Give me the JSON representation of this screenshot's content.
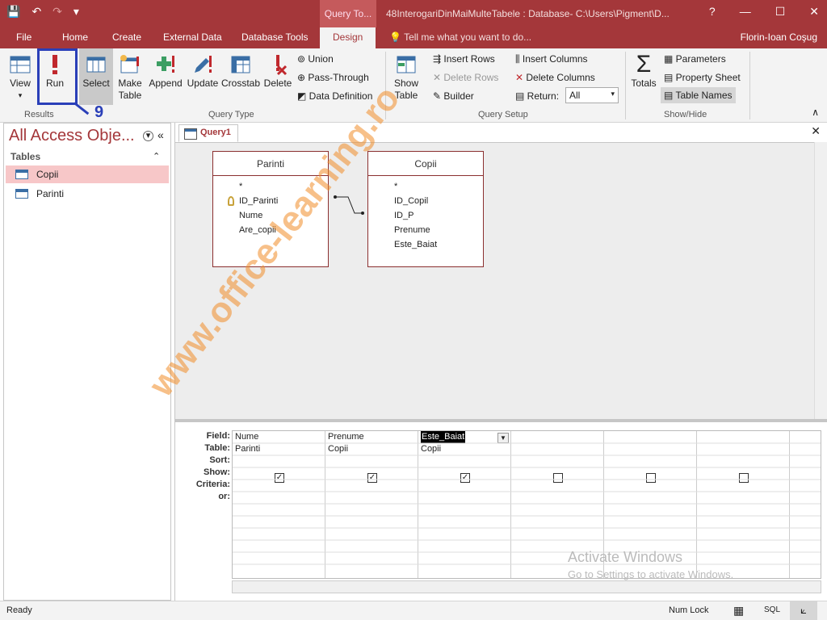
{
  "titlebar": {
    "context_tab": "Query To...",
    "document": "48InterogariDinMaiMulteTabele : Database- C:\\Users\\Pigment\\D...",
    "help": "?",
    "minimize": "—",
    "maximize": "☐",
    "close": "✕"
  },
  "tabs": {
    "file": "File",
    "home": "Home",
    "create": "Create",
    "external": "External Data",
    "dbtools": "Database Tools",
    "design": "Design",
    "tellme": "Tell me what you want to do...",
    "user": "Florin-Ioan Coşug"
  },
  "ribbon": {
    "view": "View",
    "run": "Run",
    "select": "Select",
    "make_table": "Make Table",
    "append": "Append",
    "update": "Update",
    "crosstab": "Crosstab",
    "delete": "Delete",
    "union": "Union",
    "pass_through": "Pass-Through",
    "data_definition": "Data Definition",
    "show_table": "Show Table",
    "insert_rows": "Insert Rows",
    "delete_rows": "Delete Rows",
    "builder": "Builder",
    "insert_columns": "Insert Columns",
    "delete_columns": "Delete Columns",
    "return_label": "Return:",
    "return_value": "All",
    "totals": "Totals",
    "parameters": "Parameters",
    "property_sheet": "Property Sheet",
    "table_names": "Table Names",
    "group_results": "Results",
    "group_query_type": "Query Type",
    "group_query_setup": "Query Setup",
    "group_show_hide": "Show/Hide"
  },
  "annotation": {
    "number": "9"
  },
  "nav": {
    "title": "All Access Obje...",
    "section": "Tables",
    "items": [
      {
        "label": "Copii"
      },
      {
        "label": "Parinti"
      }
    ]
  },
  "doc": {
    "tab": "Query1"
  },
  "tables": [
    {
      "name": "Parinti",
      "fields": [
        "*",
        "ID_Parinti",
        "Nume",
        "Are_copii"
      ]
    },
    {
      "name": "Copii",
      "fields": [
        "*",
        "ID_Copil",
        "ID_P",
        "Prenume",
        "Este_Baiat"
      ]
    }
  ],
  "grid": {
    "row_labels": [
      "Field:",
      "Table:",
      "Sort:",
      "Show:",
      "Criteria:",
      "or:"
    ],
    "columns": [
      {
        "field": "Nume",
        "table": "Parinti",
        "show": true
      },
      {
        "field": "Prenume",
        "table": "Copii",
        "show": true
      },
      {
        "field": "Este_Baiat",
        "table": "Copii",
        "show": true
      },
      {
        "field": "",
        "table": "",
        "show": false
      },
      {
        "field": "",
        "table": "",
        "show": false
      },
      {
        "field": "",
        "table": "",
        "show": false
      }
    ]
  },
  "watermark": "www.office-learning.ro",
  "activate": {
    "line1": "Activate Windows",
    "line2": "Go to Settings to activate Windows."
  },
  "status": {
    "left": "Ready",
    "numlock": "Num Lock",
    "sql": "SQL"
  },
  "colors": {
    "accent": "#a4373a",
    "annotation": "#2a3fb8",
    "watermark": "#f08c28"
  }
}
